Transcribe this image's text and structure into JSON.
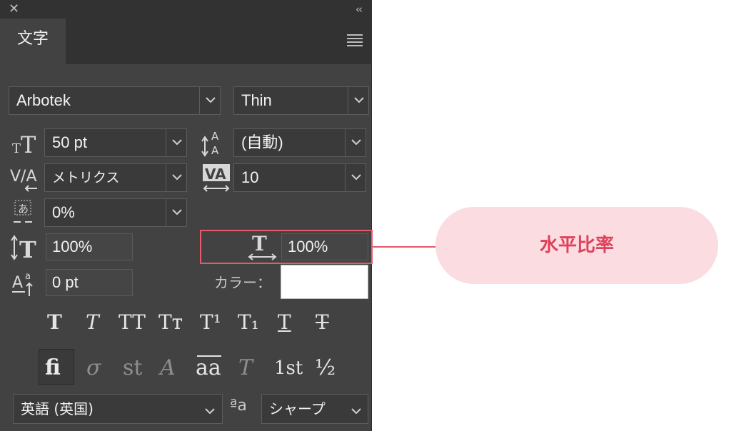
{
  "panel": {
    "tab_label": "文字",
    "font_family": "Arbotek",
    "font_style": "Thin",
    "font_size": "50 pt",
    "leading": "(自動)",
    "kerning": "メトリクス",
    "tracking": "10",
    "tsume": "0%",
    "vertical_scale": "100%",
    "horizontal_scale": "100%",
    "baseline_shift": "0 pt",
    "color_label": "カラー：",
    "color_value": "#ffffff",
    "type_styles": [
      "T",
      "T",
      "TT",
      "Tт",
      "T¹",
      "T₁",
      "T",
      "T"
    ],
    "opentype_features": [
      "fi",
      "σ",
      "st",
      "A",
      "aa",
      "T",
      "1st",
      "½"
    ],
    "language": "英語 (英国)",
    "antialias_icon": "ªa",
    "antialias": "シャープ"
  },
  "annotation": {
    "label": "水平比率",
    "accent_color": "#e55a6e"
  }
}
